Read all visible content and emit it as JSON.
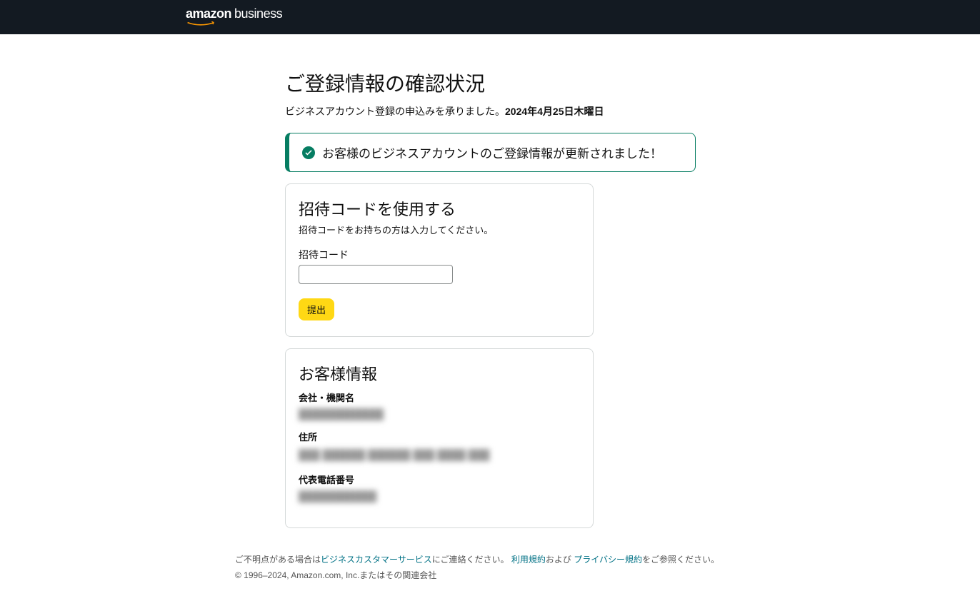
{
  "header": {
    "logo_amazon": "amazon",
    "logo_business": "business"
  },
  "page": {
    "title": "ご登録情報の確認状況",
    "subtitle_text": "ビジネスアカウント登録の申込みを承りました。",
    "subtitle_date": "2024年4月25日木曜日"
  },
  "alert": {
    "message": "お客様のビジネスアカウントのご登録情報が更新されました！"
  },
  "invite_card": {
    "title": "招待コードを使用する",
    "subtitle": "招待コードをお持ちの方は入力してください。",
    "input_label": "招待コード",
    "input_value": "",
    "submit_label": "提出"
  },
  "customer_info": {
    "title": "お客様情報",
    "company_label": "会社・機関名",
    "company_value": "████████████",
    "address_label": "住所",
    "address_value": "███ ██████ ██████ ███ ████\n███",
    "phone_label": "代表電話番号",
    "phone_value": "███████████"
  },
  "footer": {
    "contact_prefix": "ご不明点がある場合は",
    "contact_link": "ビジネスカスタマーサービス",
    "contact_suffix": "にご連絡ください。 ",
    "terms_link": "利用規約",
    "terms_middle": "および ",
    "privacy_link": "プライバシー規約",
    "privacy_suffix": "をご参照ください。",
    "copyright": "© 1996–2024, Amazon.com, Inc.またはその関連会社"
  }
}
